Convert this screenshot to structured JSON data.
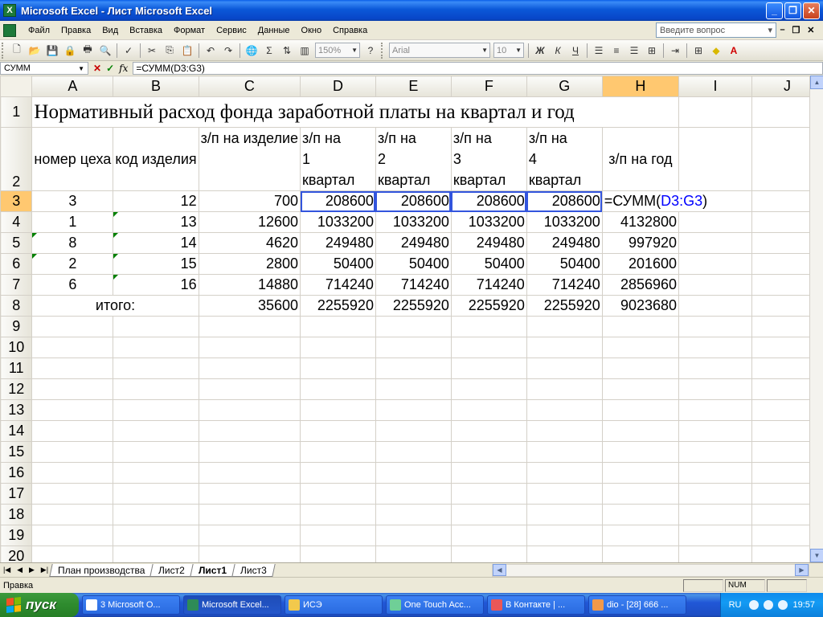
{
  "window": {
    "title": "Microsoft Excel - Лист Microsoft Excel",
    "app_icon": "X",
    "controls": [
      "_",
      "❐",
      "✕"
    ]
  },
  "menu": {
    "items": [
      "Файл",
      "Правка",
      "Вид",
      "Вставка",
      "Формат",
      "Сервис",
      "Данные",
      "Окно",
      "Справка"
    ],
    "help_placeholder": "Введите вопрос",
    "doc_controls": [
      "–",
      "❐",
      "✕"
    ]
  },
  "toolbar": {
    "zoom": "150%",
    "font": "Arial",
    "font_size": "10",
    "sigma": "Σ",
    "bold": "Ж",
    "italic": "К",
    "underline": "Ч"
  },
  "formula_bar": {
    "name_box": "СУММ",
    "fx": "fx",
    "formula": "=СУММ(D3:G3)"
  },
  "columns": [
    "A",
    "B",
    "C",
    "D",
    "E",
    "F",
    "G",
    "H",
    "I",
    "J"
  ],
  "active_column": "H",
  "active_row": 3,
  "sheet": {
    "title": "Нормативный расход фонда заработной платы на квартал и год",
    "headers": {
      "a": "номер цеха",
      "b": "код изделия",
      "c": "з/п на изделие",
      "d": [
        "з/п на",
        "1",
        "квартал"
      ],
      "e": [
        "з/п на",
        "2",
        "квартал"
      ],
      "f": [
        "з/п на",
        "3",
        "квартал"
      ],
      "g": [
        "з/п на",
        "4",
        "квартал"
      ],
      "h": "з/п на год"
    },
    "rows": [
      {
        "a": "3",
        "b": "12",
        "c": "700",
        "d": "208600",
        "e": "208600",
        "f": "208600",
        "g": "208600",
        "h_prefix": "=СУММ(",
        "h_ref": "D3:G3",
        "h_suffix": ")"
      },
      {
        "a": "1",
        "b": "13",
        "c": "12600",
        "d": "1033200",
        "e": "1033200",
        "f": "1033200",
        "g": "1033200",
        "h": "4132800"
      },
      {
        "a": "8",
        "b": "14",
        "c": "4620",
        "d": "249480",
        "e": "249480",
        "f": "249480",
        "g": "249480",
        "h": "997920"
      },
      {
        "a": "2",
        "b": "15",
        "c": "2800",
        "d": "50400",
        "e": "50400",
        "f": "50400",
        "g": "50400",
        "h": "201600"
      },
      {
        "a": "6",
        "b": "16",
        "c": "14880",
        "d": "714240",
        "e": "714240",
        "f": "714240",
        "g": "714240",
        "h": "2856960"
      }
    ],
    "total": {
      "label": "итого:",
      "c": "35600",
      "d": "2255920",
      "e": "2255920",
      "f": "2255920",
      "g": "2255920",
      "h": "9023680"
    },
    "row_numbers": [
      "1",
      "2",
      "3",
      "4",
      "5",
      "6",
      "7",
      "8",
      "9",
      "10",
      "11",
      "12",
      "13",
      "14",
      "15",
      "16",
      "17",
      "18",
      "19",
      "20"
    ]
  },
  "tabs": [
    "План производства",
    "Лист2",
    "Лист1",
    "Лист3"
  ],
  "active_tab": "Лист1",
  "status": {
    "mode": "Правка",
    "num": "NUM"
  },
  "taskbar": {
    "start": "пуск",
    "buttons": [
      "3 Microsoft O...",
      "Microsoft Excel...",
      "ИСЭ",
      "One Touch Acc...",
      "В Контакте | ...",
      "dio - [28] 666 ..."
    ],
    "active_index": 1,
    "lang": "RU",
    "clock": "19:57"
  }
}
